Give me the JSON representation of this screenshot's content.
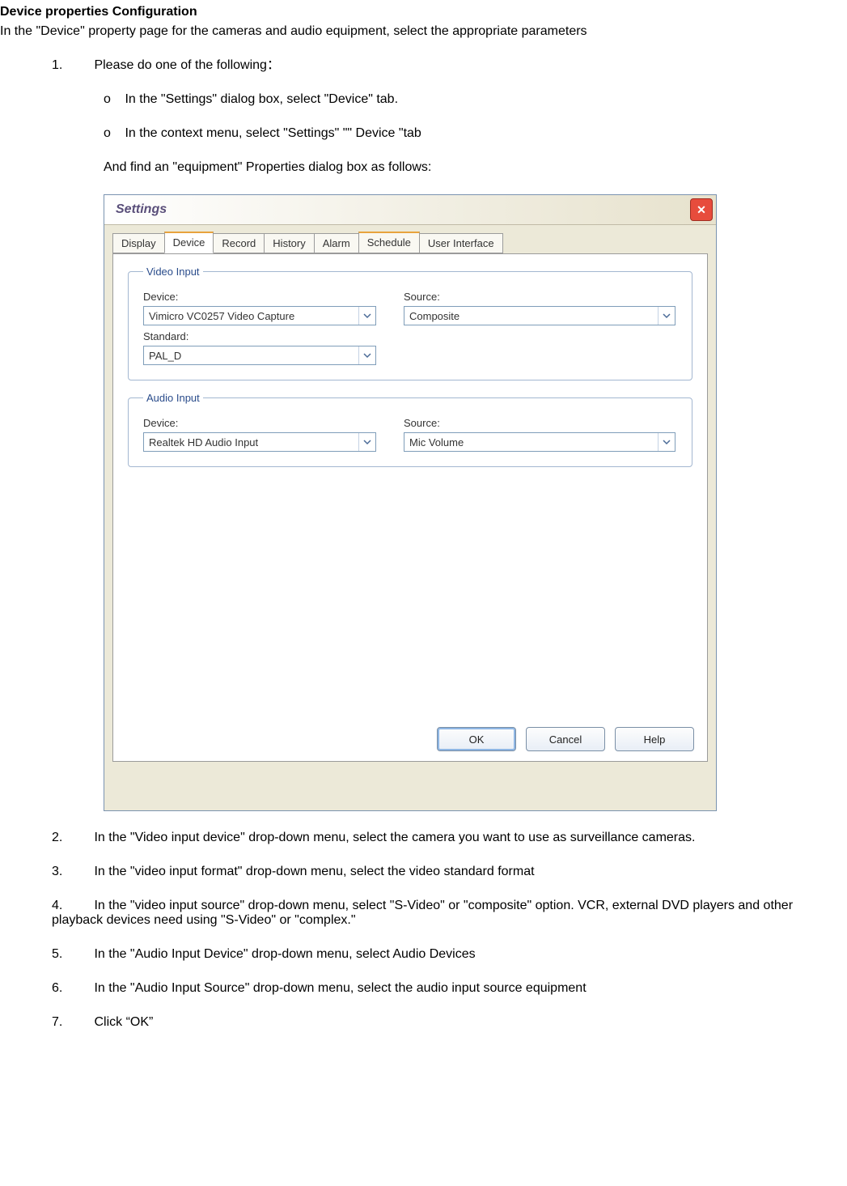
{
  "doc": {
    "heading": "Device properties Configuration",
    "intro": "In the \"Device\" property page for the cameras and audio equipment, select the appropriate parameters",
    "items": {
      "i1_num": "1.",
      "i1_text": "Please do one of the following：",
      "i1_sub_a_bullet": "o",
      "i1_sub_a_text": "In the \"Settings\" dialog box, select \"Device\" tab.",
      "i1_sub_b_bullet": "o",
      "i1_sub_b_text": "In the context menu, select \"Settings\" \"\" Device \"tab",
      "i1_note": "And find an \"equipment\" Properties dialog box as follows:",
      "i2_num": "2.",
      "i2_text": "In the \"Video input device\" drop-down menu, select the camera you want to use as surveillance cameras.",
      "i3_num": "3.",
      "i3_text": "In the \"video input format\" drop-down menu, select the video standard format",
      "i4_num": "4.",
      "i4_text": "In the \"video input source\" drop-down menu, select \"S-Video\" or \"composite\" option.    VCR, external DVD players and other playback devices need using \"S-Video\" or \"complex.\"",
      "i5_num": "5.",
      "i5_text": "In the \"Audio Input Device\" drop-down menu, select Audio Devices",
      "i6_num": "6.",
      "i6_text": "In the \"Audio Input Source\" drop-down menu, select the audio input source equipment",
      "i7_num": "7.",
      "i7_text": "Click “OK”"
    }
  },
  "dialog": {
    "title": "Settings",
    "tabs": {
      "display": "Display",
      "device": "Device",
      "record": "Record",
      "history": "History",
      "alarm": "Alarm",
      "schedule": "Schedule",
      "ui": "User Interface"
    },
    "video_group": {
      "legend": "Video Input",
      "device_label": "Device:",
      "device_value": "Vimicro VC0257 Video Capture",
      "source_label": "Source:",
      "source_value": "Composite",
      "standard_label": "Standard:",
      "standard_value": "PAL_D"
    },
    "audio_group": {
      "legend": "Audio Input",
      "device_label": "Device:",
      "device_value": "Realtek HD Audio Input",
      "source_label": "Source:",
      "source_value": "Mic Volume"
    },
    "buttons": {
      "ok": "OK",
      "cancel": "Cancel",
      "help": "Help"
    }
  }
}
